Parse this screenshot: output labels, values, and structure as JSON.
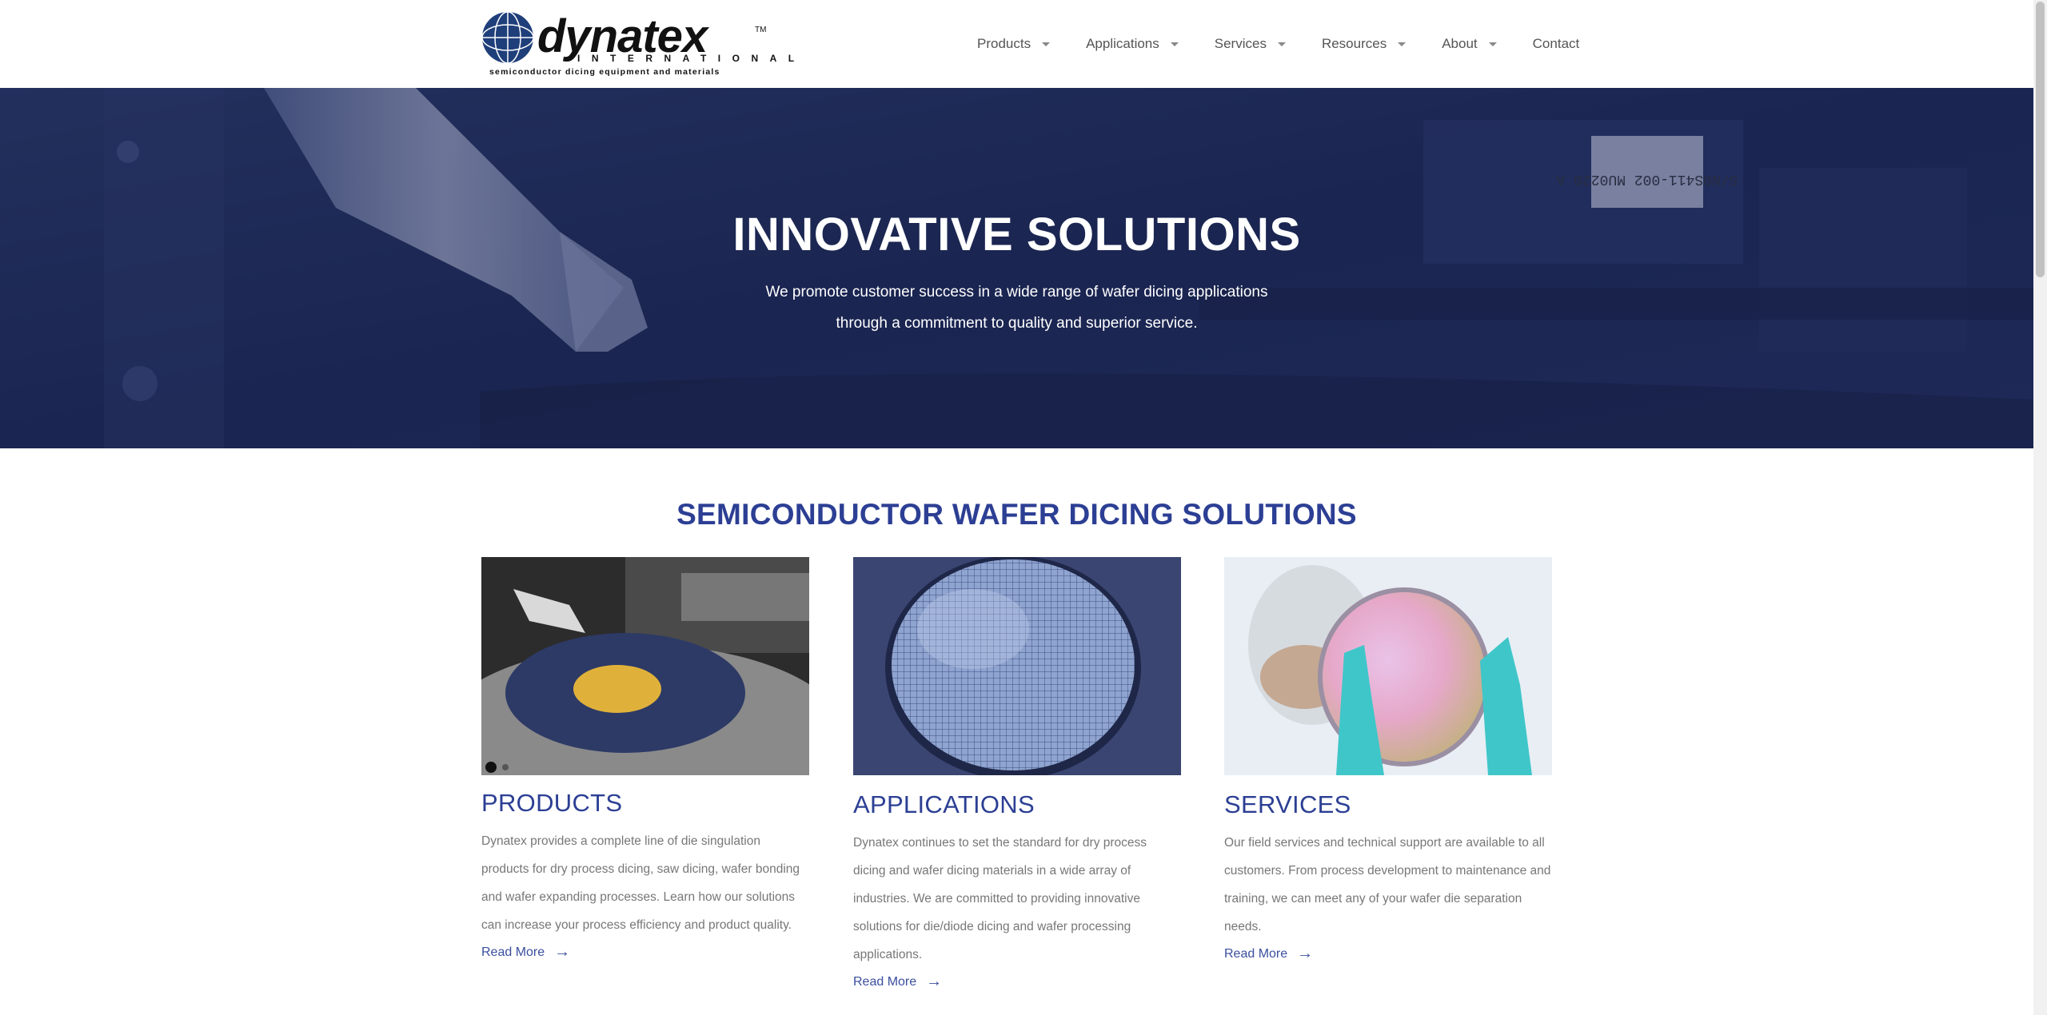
{
  "logo": {
    "wordmark": "dynatex",
    "tm": "TM",
    "subline": "INTERNATIONAL",
    "tagline": "semiconductor dicing equipment and materials"
  },
  "nav": [
    {
      "label": "Products",
      "has_dropdown": true
    },
    {
      "label": "Applications",
      "has_dropdown": true
    },
    {
      "label": "Services",
      "has_dropdown": true
    },
    {
      "label": "Resources",
      "has_dropdown": true
    },
    {
      "label": "About",
      "has_dropdown": true
    },
    {
      "label": "Contact",
      "has_dropdown": false
    }
  ],
  "hero": {
    "title": "INNOVATIVE SOLUTIONS",
    "subtitle_line1": "We promote customer success in a wide range of wafer dicing applications",
    "subtitle_line2": "through a commitment to quality and superior service.",
    "label_text": "S/N0S411-002 MU0220 A"
  },
  "section": {
    "title": "SEMICONDUCTOR WAFER DICING SOLUTIONS"
  },
  "cards": [
    {
      "title": "PRODUCTS",
      "text": "Dynatex provides a complete line of die singulation products for dry process dicing, saw dicing, wafer bonding and wafer expanding processes. Learn how our solutions can increase your process efficiency and product quality.",
      "link": "Read More"
    },
    {
      "title": "APPLICATIONS",
      "text": "Dynatex continues to set the standard for dry process dicing and wafer dicing materials in a wide array of industries. We are committed to providing innovative solutions for die/diode dicing and wafer processing applications.",
      "link": "Read More"
    },
    {
      "title": "SERVICES",
      "text": "Our field services and technical support are available to all customers. From process development to maintenance and training, we can meet any of your wafer die separation needs.",
      "link": "Read More"
    }
  ],
  "colors": {
    "brand_blue": "#2c3f94",
    "hero_overlay": "#1d2a55",
    "nav_text": "#555555",
    "body_text": "#777777"
  }
}
